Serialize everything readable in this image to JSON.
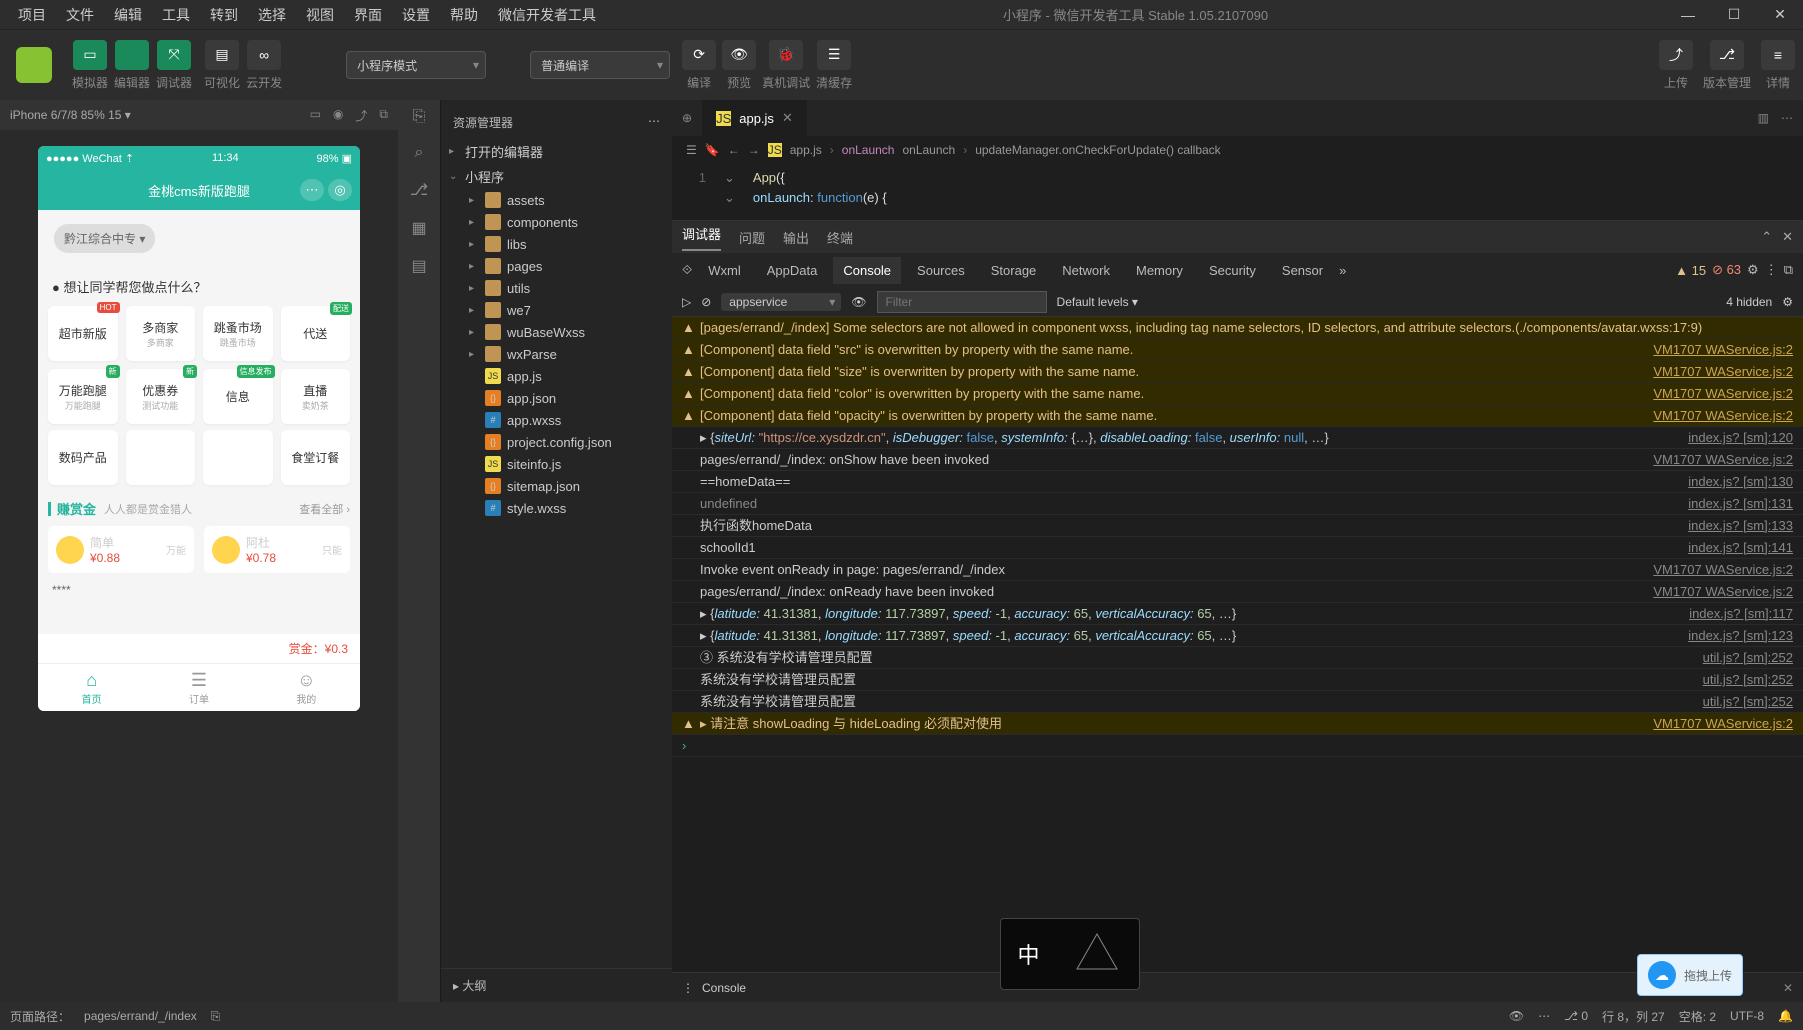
{
  "menubar": [
    "项目",
    "文件",
    "编辑",
    "工具",
    "转到",
    "选择",
    "视图",
    "界面",
    "设置",
    "帮助",
    "微信开发者工具"
  ],
  "app_title": "小程序 - 微信开发者工具 Stable 1.05.2107090",
  "toolbar": {
    "modes": [
      {
        "icon": "▭",
        "label": "模拟器"
      },
      {
        "icon": "</>",
        "label": "编辑器"
      },
      {
        "icon": "⤧",
        "label": "调试器"
      }
    ],
    "extra": [
      {
        "icon": "▤",
        "label": "可视化"
      },
      {
        "icon": "∞",
        "label": "云开发"
      }
    ],
    "mode_select": "小程序模式",
    "compile_select": "普通编译",
    "actions": [
      {
        "icon": "⟳",
        "label": "编译"
      },
      {
        "icon": "👁",
        "label": "预览"
      },
      {
        "icon": "🐞",
        "label": "真机调试"
      },
      {
        "icon": "☰",
        "label": "清缓存"
      }
    ],
    "right": [
      {
        "icon": "⤴",
        "label": "上传"
      },
      {
        "icon": "⎇",
        "label": "版本管理"
      },
      {
        "icon": "≡",
        "label": "详情"
      }
    ]
  },
  "device_bar": {
    "text": "iPhone 6/7/8 85% 15  ▾"
  },
  "phone": {
    "status_l": "●●●●● WeChat ⇡",
    "status_c": "11:34",
    "status_r": "98% ▣",
    "title": "金桃cms新版跑腿",
    "tag": "黔江综合中专 ▾",
    "prompt": "● 想让同学帮您做点什么？",
    "grid": [
      {
        "label": "超市新版",
        "sub": "",
        "badge": "HOT",
        "cls": ""
      },
      {
        "label": "多商家",
        "sub": "多商家"
      },
      {
        "label": "跳蚤市场",
        "sub": "跳蚤市场"
      },
      {
        "label": "代送",
        "sub": "",
        "badge": "配送",
        "cls": "g"
      },
      {
        "label": "万能跑腿",
        "sub": "万能跑腿",
        "badge": "新",
        "cls": "g"
      },
      {
        "label": "优惠券",
        "sub": "测试功能",
        "badge": "新",
        "cls": "g"
      },
      {
        "label": "信息",
        "sub": "",
        "badge": "信息发布",
        "cls": "g"
      },
      {
        "label": "直播",
        "sub": "卖奶茶"
      }
    ],
    "grid2": [
      {
        "label": "数码产品"
      },
      {
        "label": ""
      },
      {
        "label": ""
      },
      {
        "label": "食堂订餐"
      }
    ],
    "section": {
      "title": "赚赏金",
      "sub": "人人都是赏金猎人",
      "more": "查看全部 ›"
    },
    "users": [
      {
        "name": "简单",
        "tag": "万能",
        "price": "¥0.88"
      },
      {
        "name": "阿杜",
        "tag": "只能",
        "price": "¥0.78"
      }
    ],
    "stars": "****",
    "money_label": "赏金：",
    "money_val": "¥0.3",
    "tabs": [
      {
        "icon": "⌂",
        "label": "首页",
        "active": true
      },
      {
        "icon": "☰",
        "label": "订单"
      },
      {
        "icon": "☺",
        "label": "我的"
      }
    ]
  },
  "explorer": {
    "title": "资源管理器",
    "sections": [
      {
        "label": "打开的编辑器",
        "open": false
      },
      {
        "label": "小程序",
        "open": true
      }
    ],
    "tree": [
      {
        "t": "folder",
        "label": "assets"
      },
      {
        "t": "folder",
        "label": "components"
      },
      {
        "t": "folder",
        "label": "libs"
      },
      {
        "t": "folder",
        "label": "pages"
      },
      {
        "t": "folder",
        "label": "utils"
      },
      {
        "t": "folder",
        "label": "we7"
      },
      {
        "t": "folder",
        "label": "wuBaseWxss"
      },
      {
        "t": "folder",
        "label": "wxParse"
      },
      {
        "t": "js",
        "label": "app.js"
      },
      {
        "t": "json",
        "label": "app.json"
      },
      {
        "t": "wxss",
        "label": "app.wxss"
      },
      {
        "t": "json",
        "label": "project.config.json"
      },
      {
        "t": "js",
        "label": "siteinfo.js"
      },
      {
        "t": "json",
        "label": "sitemap.json"
      },
      {
        "t": "wxss",
        "label": "style.wxss"
      }
    ],
    "outline": "大纲"
  },
  "editor": {
    "tab": "app.js",
    "crumbs": [
      "app.js",
      "onLaunch",
      "updateManager.onCheckForUpdate() callback"
    ],
    "lines": [
      {
        "n": "1",
        "chev": "⌄",
        "code": "App({"
      },
      {
        "n": "",
        "chev": "⌄",
        "code": "  onLaunch: function(e) {"
      },
      {
        "n": "",
        "chev": "",
        "code": ""
      }
    ]
  },
  "devtools": {
    "top_tabs": [
      "调试器",
      "问题",
      "输出",
      "终端"
    ],
    "sub_tabs": [
      "Wxml",
      "AppData",
      "Console",
      "Sources",
      "Storage",
      "Network",
      "Memory",
      "Security",
      "Sensor"
    ],
    "warn_count": "15",
    "err_count": "63",
    "context": "appservice",
    "filter_ph": "Filter",
    "levels": "Default levels ▾",
    "hidden": "4 hidden",
    "rows": [
      {
        "t": "warn",
        "msg": "[pages/errand/_/index] Some selectors are not allowed in component wxss, including tag name selectors, ID selectors, and attribute selectors.(./components/avatar.wxss:17:9)",
        "src": ""
      },
      {
        "t": "warn",
        "msg": "[Component] data field \"src\" is overwritten by property with the same name.",
        "src": "VM1707 WAService.js:2"
      },
      {
        "t": "warn",
        "msg": "[Component] data field \"size\" is overwritten by property with the same name.",
        "src": "VM1707 WAService.js:2"
      },
      {
        "t": "warn",
        "msg": "[Component] data field \"color\" is overwritten by property with the same name.",
        "src": "VM1707 WAService.js:2"
      },
      {
        "t": "warn",
        "msg": "[Component] data field \"opacity\" is overwritten by property with the same name.",
        "src": "VM1707 WAService.js:2"
      },
      {
        "t": "log",
        "html": "▸ <span class='par'>{</span><span class='s-key'>siteUrl:</span> <span class='s-str'>\"https://ce.xysdzdr.cn\"</span>, <span class='s-key'>isDebugger:</span> <span class='s-bool'>false</span>, <span class='s-key'>systemInfo:</span> <span class='par'>{…}</span>, <span class='s-key'>disableLoading:</span> <span class='s-bool'>false</span>, <span class='s-key'>userInfo:</span> <span class='s-null'>null</span>, …<span class='par'>}</span>",
        "src": "index.js? [sm]:120"
      },
      {
        "t": "log",
        "msg": "pages/errand/_/index: onShow have been invoked",
        "src": "VM1707 WAService.js:2"
      },
      {
        "t": "log",
        "msg": "==homeData==",
        "src": "index.js? [sm]:130"
      },
      {
        "t": "log",
        "msg": "undefined",
        "src": "index.js? [sm]:131",
        "dim": true
      },
      {
        "t": "log",
        "msg": "执行函数homeData",
        "src": "index.js? [sm]:133"
      },
      {
        "t": "log",
        "msg": "schoolId1",
        "src": "index.js? [sm]:141"
      },
      {
        "t": "log",
        "msg": "Invoke event onReady in page: pages/errand/_/index",
        "src": "VM1707 WAService.js:2"
      },
      {
        "t": "log",
        "msg": "pages/errand/_/index: onReady have been invoked",
        "src": "VM1707 WAService.js:2"
      },
      {
        "t": "log",
        "html": "▸ <span class='par'>{</span><span class='s-key'>latitude:</span> <span class='s-num'>41.31381</span>, <span class='s-key'>longitude:</span> <span class='s-num'>117.73897</span>, <span class='s-key'>speed:</span> <span class='s-num'>-1</span>, <span class='s-key'>accuracy:</span> <span class='s-num'>65</span>, <span class='s-key'>verticalAccuracy:</span> <span class='s-num'>65</span>, …<span class='par'>}</span>",
        "src": "index.js? [sm]:117"
      },
      {
        "t": "log",
        "html": "▸ <span class='par'>{</span><span class='s-key'>latitude:</span> <span class='s-num'>41.31381</span>, <span class='s-key'>longitude:</span> <span class='s-num'>117.73897</span>, <span class='s-key'>speed:</span> <span class='s-num'>-1</span>, <span class='s-key'>accuracy:</span> <span class='s-num'>65</span>, <span class='s-key'>verticalAccuracy:</span> <span class='s-num'>65</span>, …<span class='par'>}</span>",
        "src": "index.js? [sm]:123"
      },
      {
        "t": "log",
        "msg": "③ 系统没有学校请管理员配置",
        "src": "util.js? [sm]:252"
      },
      {
        "t": "log",
        "msg": "系统没有学校请管理员配置",
        "src": "util.js? [sm]:252"
      },
      {
        "t": "log",
        "msg": "系统没有学校请管理员配置",
        "src": "util.js? [sm]:252"
      },
      {
        "t": "warn",
        "msg": "▸ 请注意 showLoading 与 hideLoading 必须配对使用",
        "src": "VM1707 WAService.js:2"
      }
    ],
    "drawer": "Console"
  },
  "statusbar": {
    "route_lbl": "页面路径：",
    "route": "pages/errand/_/index",
    "cursor": "行 8，列 27",
    "spaces": "空格: 2",
    "enc": "UTF-8"
  },
  "cloud_upload": "拖拽上传",
  "ime": "中"
}
